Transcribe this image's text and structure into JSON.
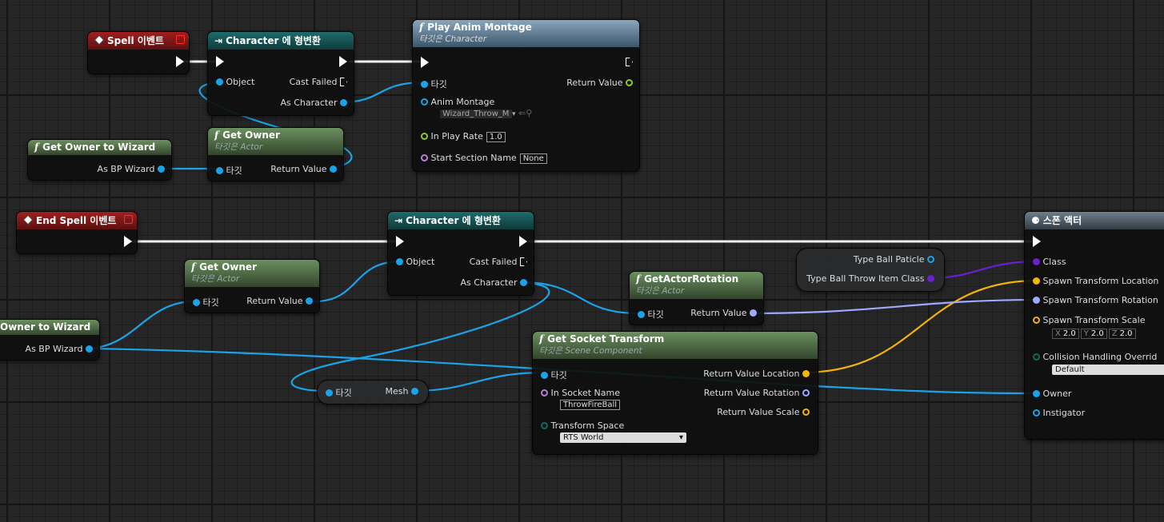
{
  "colors": {
    "exec": "#ffffff",
    "object": "#1aa3e8",
    "float": "#8ac926",
    "struct": "#f4b400",
    "rotator": "#a0a8ff",
    "class": "#6a1fd1",
    "name": "#b77fd8",
    "text": "#d879c6",
    "enum": "#0a6b63"
  },
  "nodes": {
    "spell_event": {
      "title": "Spell 이벤트"
    },
    "cast1": {
      "title": "Character 에 형변환",
      "object": "Object",
      "cast_failed": "Cast Failed",
      "as_character": "As Character"
    },
    "play_anim": {
      "title": "Play Anim Montage",
      "subtitle": "타깃은 Character",
      "target": "타깃",
      "return_value": "Return Value",
      "anim_montage": "Anim Montage",
      "anim_montage_value": "Wizard_Throw_M",
      "in_play_rate": "In Play Rate",
      "in_play_rate_value": "1.0",
      "start_section": "Start Section Name",
      "start_section_value": "None"
    },
    "get_owner_wizard1": {
      "title": "Get Owner to Wizard",
      "as_bp_wizard": "As BP Wizard"
    },
    "get_owner1": {
      "title": "Get Owner",
      "subtitle": "타깃은 Actor",
      "target": "타깃",
      "return_value": "Return Value"
    },
    "end_spell_event": {
      "title": "End Spell 이벤트"
    },
    "cast2": {
      "title": "Character 에 형변환",
      "object": "Object",
      "cast_failed": "Cast Failed",
      "as_character": "As Character"
    },
    "get_owner2": {
      "title": "Get Owner",
      "subtitle": "타깃은 Actor",
      "target": "타깃",
      "return_value": "Return Value"
    },
    "get_owner_wizard2": {
      "title": "Owner to Wizard",
      "as_bp_wizard": "As BP Wizard"
    },
    "get_actor_rotation": {
      "title": "GetActorRotation",
      "subtitle": "타깃은 Actor",
      "target": "타깃",
      "return_value": "Return Value"
    },
    "type_ball_var": {
      "particle": "Type Ball Paticle",
      "throw_item": "Type Ball Throw Item Class"
    },
    "get_socket": {
      "title": "Get Socket Transform",
      "subtitle": "타깃은 Scene Component",
      "target": "타깃",
      "in_socket": "In Socket Name",
      "in_socket_value": "ThrowFireBall",
      "transform_space": "Transform Space",
      "transform_space_value": "RTS World",
      "rv_location": "Return Value Location",
      "rv_rotation": "Return Value Rotation",
      "rv_scale": "Return Value Scale"
    },
    "mesh_var": {
      "target": "타깃",
      "mesh": "Mesh"
    },
    "spawn_actor": {
      "title": "스폰 액터",
      "class": "Class",
      "location": "Spawn Transform Location",
      "rotation": "Spawn Transform Rotation",
      "scale": "Spawn Transform Scale",
      "scale_x": "2.0",
      "scale_y": "2.0",
      "scale_z": "2.0",
      "x_label": "X",
      "y_label": "Y",
      "z_label": "Z",
      "collision": "Collision Handling Overrid",
      "collision_value": "Default",
      "owner": "Owner",
      "instigator": "Instigator"
    }
  }
}
